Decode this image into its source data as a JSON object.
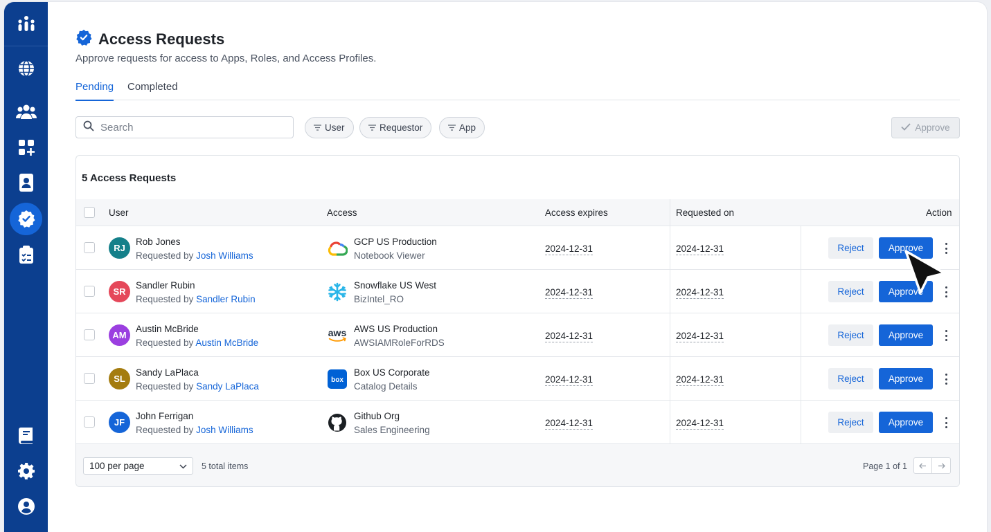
{
  "nav": {
    "items": [
      "logo",
      "globe",
      "users",
      "apps",
      "directory",
      "access-requests",
      "checklist",
      "docs",
      "settings",
      "profile"
    ]
  },
  "header": {
    "title": "Access Requests",
    "subtitle": "Approve requests for access to Apps, Roles, and Access Profiles."
  },
  "tabs": [
    {
      "label": "Pending",
      "active": true
    },
    {
      "label": "Completed",
      "active": false
    }
  ],
  "toolbar": {
    "search_placeholder": "Search",
    "filters": [
      "User",
      "Requestor",
      "App"
    ],
    "approve_label": "Approve"
  },
  "table": {
    "title": "5 Access Requests",
    "columns": {
      "user": "User",
      "access": "Access",
      "expires": "Access expires",
      "requested": "Requested on",
      "action": "Action"
    },
    "requested_by_prefix": "Requested by",
    "reject_label": "Reject",
    "approve_label": "Approve",
    "rows": [
      {
        "initials": "RJ",
        "avatar_color": "#14808a",
        "name": "Rob Jones",
        "requested_by": "Josh Williams",
        "app_icon": "gcp-icon",
        "app": "GCP US Production",
        "role": "Notebook Viewer",
        "expires": "2024-12-31",
        "requested": "2024-12-31"
      },
      {
        "initials": "SR",
        "avatar_color": "#e5485a",
        "name": "Sandler Rubin",
        "requested_by": "Sandler Rubin",
        "app_icon": "snowflake-icon",
        "app": "Snowflake US West",
        "role": "BizIntel_RO",
        "expires": "2024-12-31",
        "requested": "2024-12-31"
      },
      {
        "initials": "AM",
        "avatar_color": "#9b3fe0",
        "name": "Austin McBride",
        "requested_by": "Austin McBride",
        "app_icon": "aws-icon",
        "app": "AWS US Production",
        "role": "AWSIAMRoleForRDS",
        "expires": "2024-12-31",
        "requested": "2024-12-31"
      },
      {
        "initials": "SL",
        "avatar_color": "#a47c0f",
        "name": "Sandy LaPlaca",
        "requested_by": "Sandy LaPlaca",
        "app_icon": "box-icon",
        "app": "Box US Corporate",
        "role": "Catalog Details",
        "expires": "2024-12-31",
        "requested": "2024-12-31"
      },
      {
        "initials": "JF",
        "avatar_color": "#1565d8",
        "name": "John Ferrigan",
        "requested_by": "Josh Williams",
        "app_icon": "github-icon",
        "app": "Github Org",
        "role": "Sales Engineering",
        "expires": "2024-12-31",
        "requested": "2024-12-31"
      }
    ]
  },
  "footer": {
    "per_page": "100 per page",
    "total": "5 total items",
    "page_info": "Page 1 of 1"
  },
  "app_logo_text": {
    "aws": "aws",
    "box": "box"
  },
  "colors": {
    "sidebar": "#0c3f8f",
    "accent": "#1565d8"
  }
}
